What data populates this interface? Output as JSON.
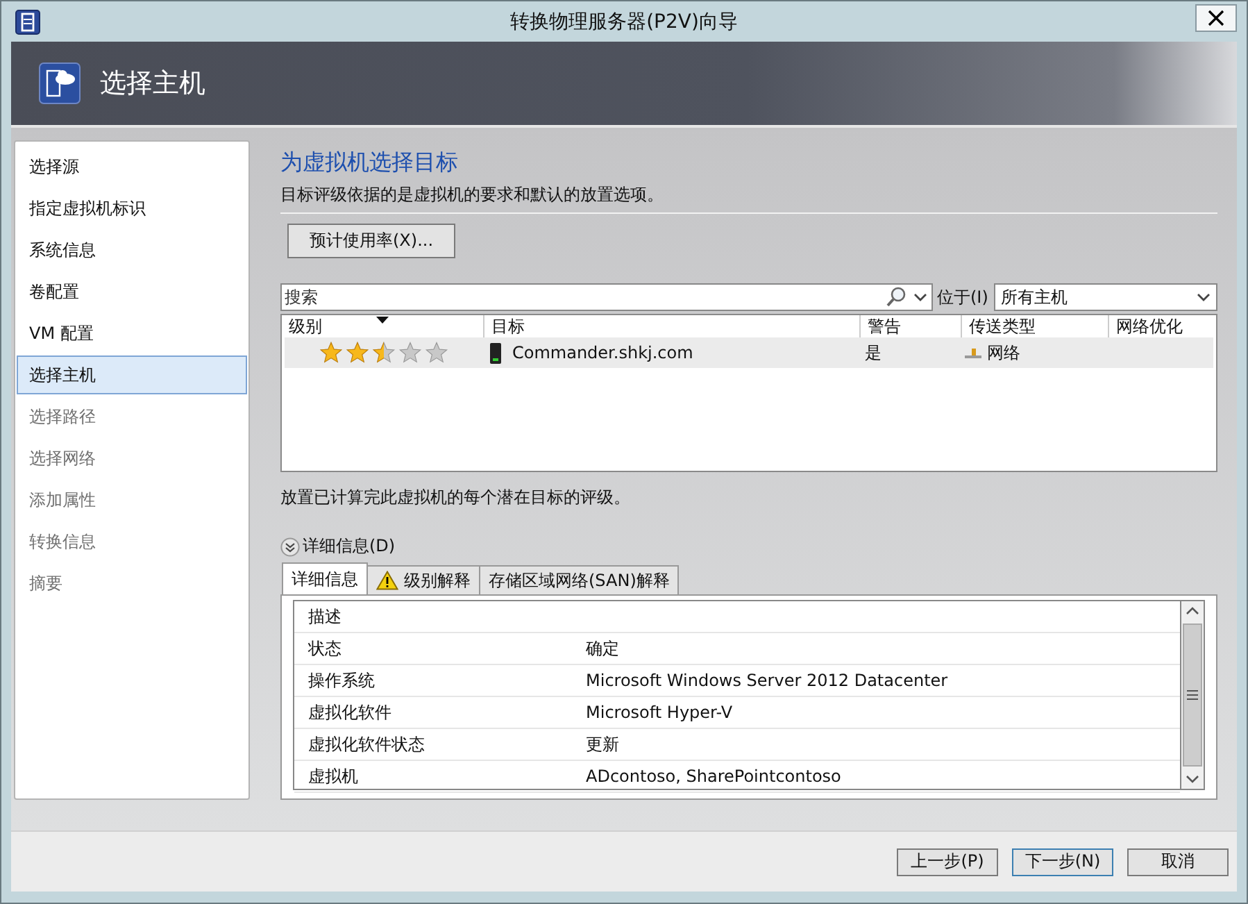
{
  "window": {
    "title": "转换物理服务器(P2V)向导"
  },
  "header": {
    "title": "选择主机"
  },
  "sidebar": {
    "items": [
      {
        "label": "选择源",
        "selected": false,
        "disabled": false
      },
      {
        "label": "指定虚拟机标识",
        "selected": false,
        "disabled": false
      },
      {
        "label": "系统信息",
        "selected": false,
        "disabled": false
      },
      {
        "label": "卷配置",
        "selected": false,
        "disabled": false
      },
      {
        "label": "VM 配置",
        "selected": false,
        "disabled": false
      },
      {
        "label": "选择主机",
        "selected": true,
        "disabled": false
      },
      {
        "label": "选择路径",
        "selected": false,
        "disabled": true
      },
      {
        "label": "选择网络",
        "selected": false,
        "disabled": true
      },
      {
        "label": "添加属性",
        "selected": false,
        "disabled": true
      },
      {
        "label": "转换信息",
        "selected": false,
        "disabled": true
      },
      {
        "label": "摘要",
        "selected": false,
        "disabled": true
      }
    ]
  },
  "page": {
    "heading": "为虚拟机选择目标",
    "description": "目标评级依据的是虚拟机的要求和默认的放置选项。",
    "usage_button": "预计使用率(X)..."
  },
  "search": {
    "placeholder": "搜索",
    "scope_label": "位于(I)",
    "scope_value": "所有主机"
  },
  "table": {
    "columns": [
      {
        "label": "级别",
        "sorted": true
      },
      {
        "label": "目标",
        "sorted": false
      },
      {
        "label": "警告",
        "sorted": false
      },
      {
        "label": "传送类型",
        "sorted": false
      },
      {
        "label": "网络优化",
        "sorted": false
      }
    ],
    "rows": [
      {
        "stars": 2.5,
        "target": "Commander.shkj.com",
        "warning": "是",
        "transfer_type": "网络"
      }
    ]
  },
  "note": "放置已计算完此虚拟机的每个潜在目标的评级。",
  "details_expander": {
    "label": "详细信息(D)",
    "expanded": true
  },
  "tabs": [
    {
      "label": "详细信息",
      "selected": true,
      "kind": "plain"
    },
    {
      "label": "级别解释",
      "selected": false,
      "kind": "warning"
    },
    {
      "label": "存储区域网络(SAN)解释",
      "selected": false,
      "kind": "plain"
    }
  ],
  "details": {
    "rows": [
      {
        "label": "描述"
      },
      {
        "label": "状态",
        "value": "确定"
      },
      {
        "label": "操作系统",
        "value": "Microsoft Windows Server 2012 Datacenter"
      },
      {
        "label": "虚拟化软件",
        "value": "Microsoft Hyper-V"
      },
      {
        "label": "虚拟化软件状态",
        "value": "更新"
      },
      {
        "label": "虚拟机",
        "value": "ADcontoso, SharePointcontoso"
      }
    ]
  },
  "buttons": [
    {
      "label": "上一步(P)",
      "default": false
    },
    {
      "label": "下一步(N)",
      "default": true
    },
    {
      "label": "取消",
      "default": false
    }
  ]
}
